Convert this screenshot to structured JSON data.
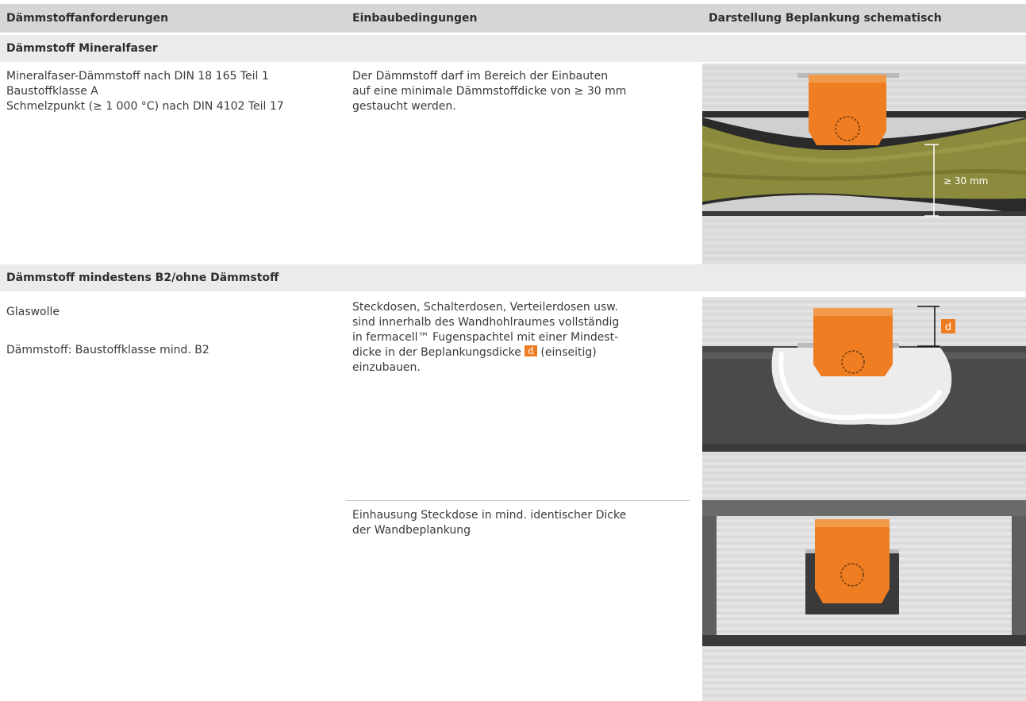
{
  "header": {
    "col1": "Dämmstoffanforderungen",
    "col2": "Einbaubedingungen",
    "col3": "Darstellung Beplankung schematisch"
  },
  "section1": {
    "title": "Dämmstoff Mineralfaser",
    "requirements": "Mineralfaser-Dämmstoff nach DIN 18 165 Teil 1\nBaustoffklasse A\nSchmelzpunkt (≥ 1 000 °C) nach DIN 4102 Teil 17",
    "conditions": "Der Dämmstoff darf im Bereich der Einbauten\nauf eine minimale Dämmstoffdicke von ≥ 30 mm\ngestaucht werden.",
    "illustration_label": "≥ 30 mm"
  },
  "section2": {
    "title": "Dämmstoff mindestens B2/ohne Dämmstoff",
    "req_line1": "Glaswolle",
    "req_line2": "Dämmstoff: Baustoffklasse mind. B2",
    "conditions_a_pre": "Steckdosen, Schalterdosen, Verteilerdosen usw.\nsind innerhalb des Wandhohlraumes vollständig\nin fermacell™ Fugenspachtel mit einer Mindest-\ndicke in der Beplankungsdicke ",
    "conditions_a_badge": "d",
    "conditions_a_post": " (einseitig)",
    "conditions_a_end": "einzubauen.",
    "illustration_label": "d",
    "conditions_b": "Einhausung Steckdose in mind. identischer Dicke\nder Wandbeplankung"
  },
  "colors": {
    "header_bg": "#d6d6d6",
    "section_bg": "#ebebeb",
    "accent_orange": "#ef7d22",
    "insulation_yellow": "#8c8a3c"
  }
}
